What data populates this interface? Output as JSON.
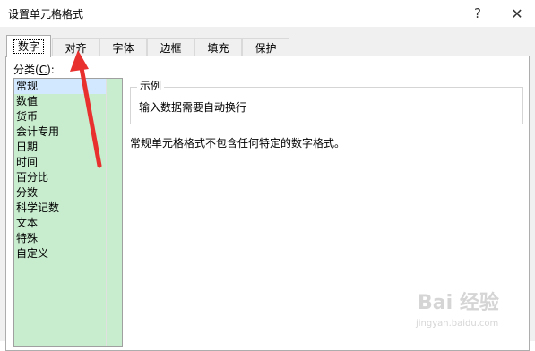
{
  "window": {
    "title": "设置单元格格式",
    "help_glyph": "?",
    "close_glyph": "✕"
  },
  "tabs": [
    {
      "label": "数字",
      "active": true
    },
    {
      "label": "对齐",
      "active": false
    },
    {
      "label": "字体",
      "active": false
    },
    {
      "label": "边框",
      "active": false
    },
    {
      "label": "填充",
      "active": false
    },
    {
      "label": "保护",
      "active": false
    }
  ],
  "category": {
    "label_prefix": "分类(",
    "label_mnemonic": "C",
    "label_suffix": "):",
    "items": [
      "常规",
      "数值",
      "货币",
      "会计专用",
      "日期",
      "时间",
      "百分比",
      "分数",
      "科学记数",
      "文本",
      "特殊",
      "自定义"
    ],
    "selected_index": 0
  },
  "sample": {
    "title": "示例",
    "value": "输入数据需要自动换行"
  },
  "description": "常规单元格格式不包含任何特定的数字格式。",
  "annotation": {
    "arrow_color": "#e8312f",
    "target": "对齐"
  },
  "colors": {
    "list_background": "#c8ecce",
    "dialog_background": "#f0f0f0"
  }
}
